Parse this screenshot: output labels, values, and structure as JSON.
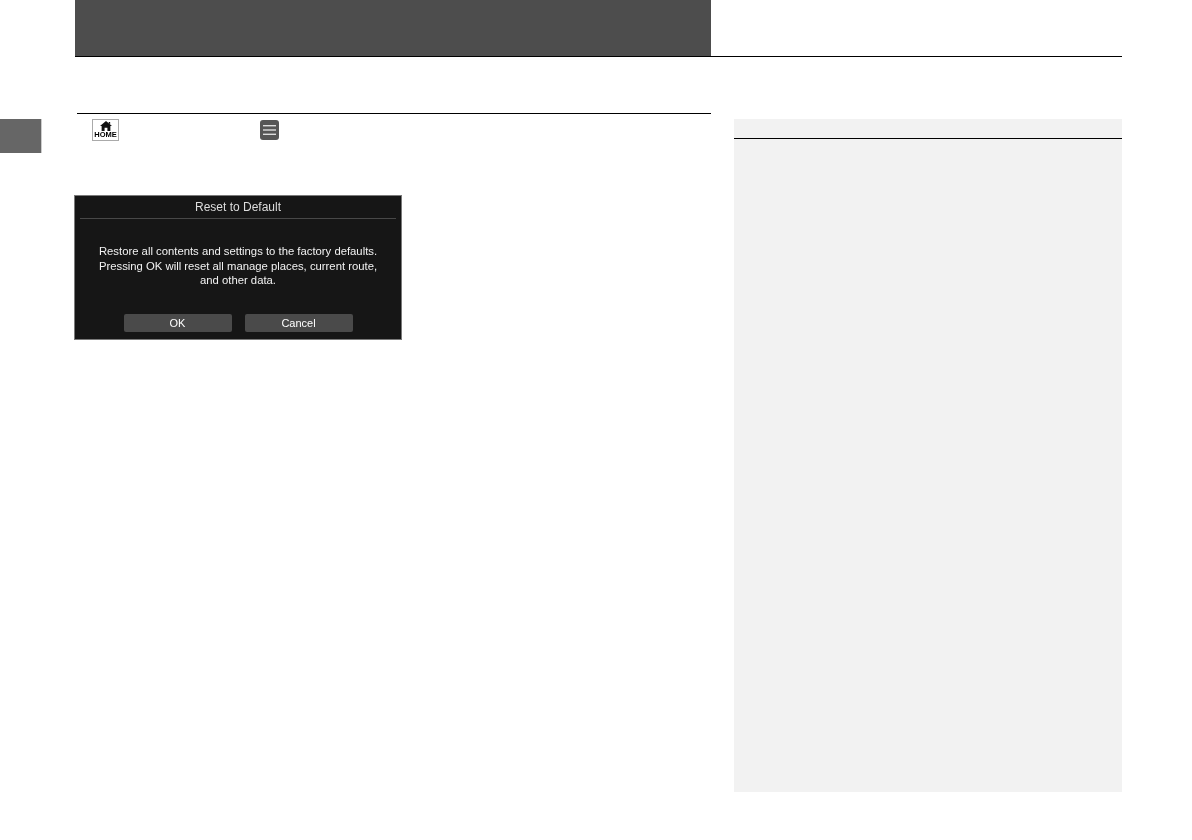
{
  "step": {
    "home_button": {
      "label": "HOME"
    }
  },
  "dialog": {
    "title": "Reset to Default",
    "message": "Restore all contents and settings to the factory defaults.\nPressing OK will reset all manage places, current route,\nand other data.",
    "buttons": [
      "OK",
      "Cancel"
    ]
  }
}
